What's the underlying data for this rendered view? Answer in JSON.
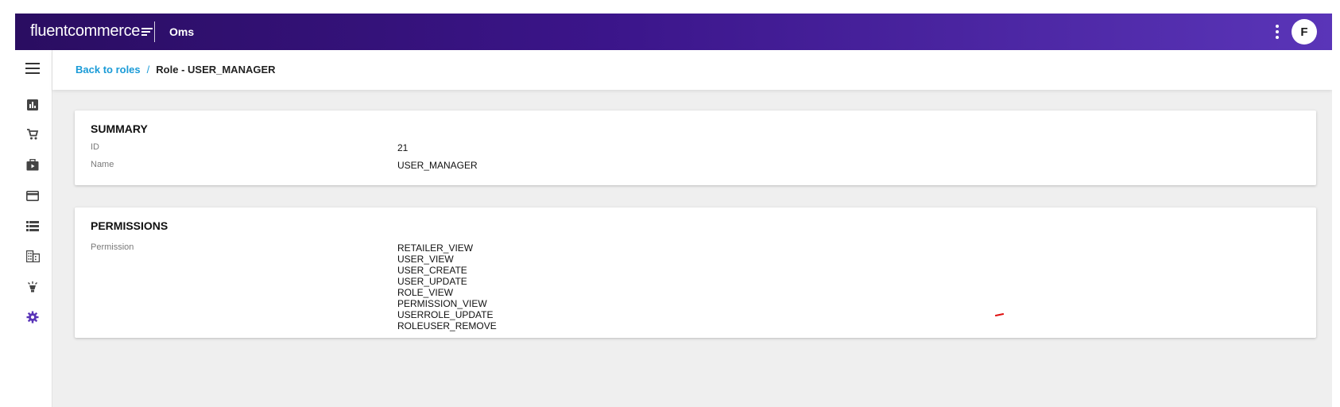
{
  "header": {
    "brand_prefix": "fluent",
    "brand_suffix": "commerce",
    "app_name": "Oms",
    "avatar_initial": "F",
    "gradient_colors": [
      "#2a0d61",
      "#5a35b8"
    ]
  },
  "sidebar": {
    "items": [
      {
        "icon": "analytics-icon"
      },
      {
        "icon": "cart-icon"
      },
      {
        "icon": "briefcase-icon"
      },
      {
        "icon": "card-icon"
      },
      {
        "icon": "list-icon"
      },
      {
        "icon": "building-icon"
      },
      {
        "icon": "lightbulb-icon"
      },
      {
        "icon": "settings-icon",
        "active": true
      }
    ],
    "active_color": "#5a35b8"
  },
  "breadcrumb": {
    "back_label": "Back to roles",
    "separator": "/",
    "current": "Role - USER_MANAGER",
    "link_color": "#1a9bd7"
  },
  "summary": {
    "title": "SUMMARY",
    "fields": [
      {
        "label": "ID",
        "value": "21"
      },
      {
        "label": "Name",
        "value": "USER_MANAGER"
      }
    ]
  },
  "permissions": {
    "title": "PERMISSIONS",
    "label": "Permission",
    "items": [
      "RETAILER_VIEW",
      "USER_VIEW",
      "USER_CREATE",
      "USER_UPDATE",
      "ROLE_VIEW",
      "PERMISSION_VIEW",
      "USERROLE_UPDATE",
      "ROLEUSER_REMOVE"
    ]
  }
}
